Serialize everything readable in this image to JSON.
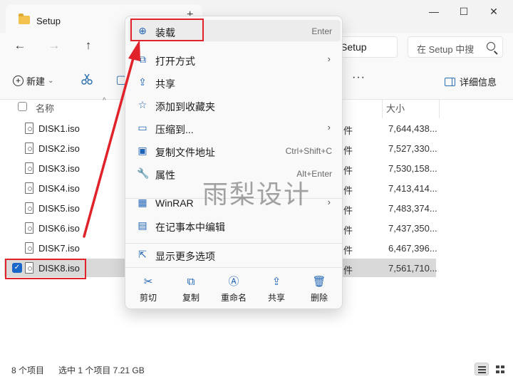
{
  "window": {
    "tab_title": "Setup",
    "tab_close": "×",
    "tab_add": "+",
    "minimize": "—",
    "maximize": "☐",
    "close": "✕"
  },
  "nav": {
    "back": "←",
    "forward": "→",
    "up": "↑",
    "address_tail": "Setup",
    "search_placeholder": "在 Setup 中搜"
  },
  "toolbar": {
    "new_label": "新建",
    "new_chevron": "⌄",
    "more": "···",
    "details_label": "详细信息"
  },
  "list": {
    "col_name": "名称",
    "col_size": "大小",
    "sort_arrow": "^",
    "files": [
      {
        "name": "DISK1.iso",
        "type": "件",
        "size": "7,644,438..."
      },
      {
        "name": "DISK2.iso",
        "type": "件",
        "size": "7,527,330..."
      },
      {
        "name": "DISK3.iso",
        "type": "件",
        "size": "7,530,158..."
      },
      {
        "name": "DISK4.iso",
        "type": "件",
        "size": "7,413,414..."
      },
      {
        "name": "DISK5.iso",
        "type": "件",
        "size": "7,483,374..."
      },
      {
        "name": "DISK6.iso",
        "type": "件",
        "size": "7,437,350..."
      },
      {
        "name": "DISK7.iso",
        "type": "件",
        "size": "6,467,396..."
      },
      {
        "name": "DISK8.iso",
        "type": "件",
        "size": "7,561,710..."
      }
    ]
  },
  "status": {
    "count": "8 个项目",
    "selection": "选中 1 个项目  7.21 GB"
  },
  "menu": {
    "items": [
      {
        "label": "装载",
        "shortcut": "Enter",
        "icon": "mount-icon"
      },
      {
        "label": "打开方式",
        "shortcut": "",
        "icon": "open-with-icon"
      },
      {
        "label": "共享",
        "shortcut": "",
        "icon": "share-icon"
      },
      {
        "label": "添加到收藏夹",
        "shortcut": "",
        "icon": "star-icon"
      },
      {
        "label": "压缩到...",
        "shortcut": "",
        "icon": "zip-icon"
      },
      {
        "label": "复制文件地址",
        "shortcut": "Ctrl+Shift+C",
        "icon": "copy-path-icon"
      },
      {
        "label": "属性",
        "shortcut": "Alt+Enter",
        "icon": "wrench-icon"
      },
      {
        "label": "WinRAR",
        "shortcut": "",
        "icon": "winrar-icon"
      },
      {
        "label": "在记事本中编辑",
        "shortcut": "",
        "icon": "notepad-icon"
      },
      {
        "label": "显示更多选项",
        "shortcut": "",
        "icon": "more-options-icon"
      }
    ],
    "quick_actions": [
      {
        "label": "剪切",
        "icon": "cut-icon"
      },
      {
        "label": "复制",
        "icon": "copy-icon"
      },
      {
        "label": "重命名",
        "icon": "rename-icon"
      },
      {
        "label": "共享",
        "icon": "share-icon"
      },
      {
        "label": "删除",
        "icon": "delete-icon"
      }
    ],
    "submenu_arrow": "›"
  },
  "watermark": "雨梨设计",
  "colors": {
    "accent": "#1a66c9",
    "annotation_red": "#e0232a",
    "selection": "#d9d9d9"
  }
}
